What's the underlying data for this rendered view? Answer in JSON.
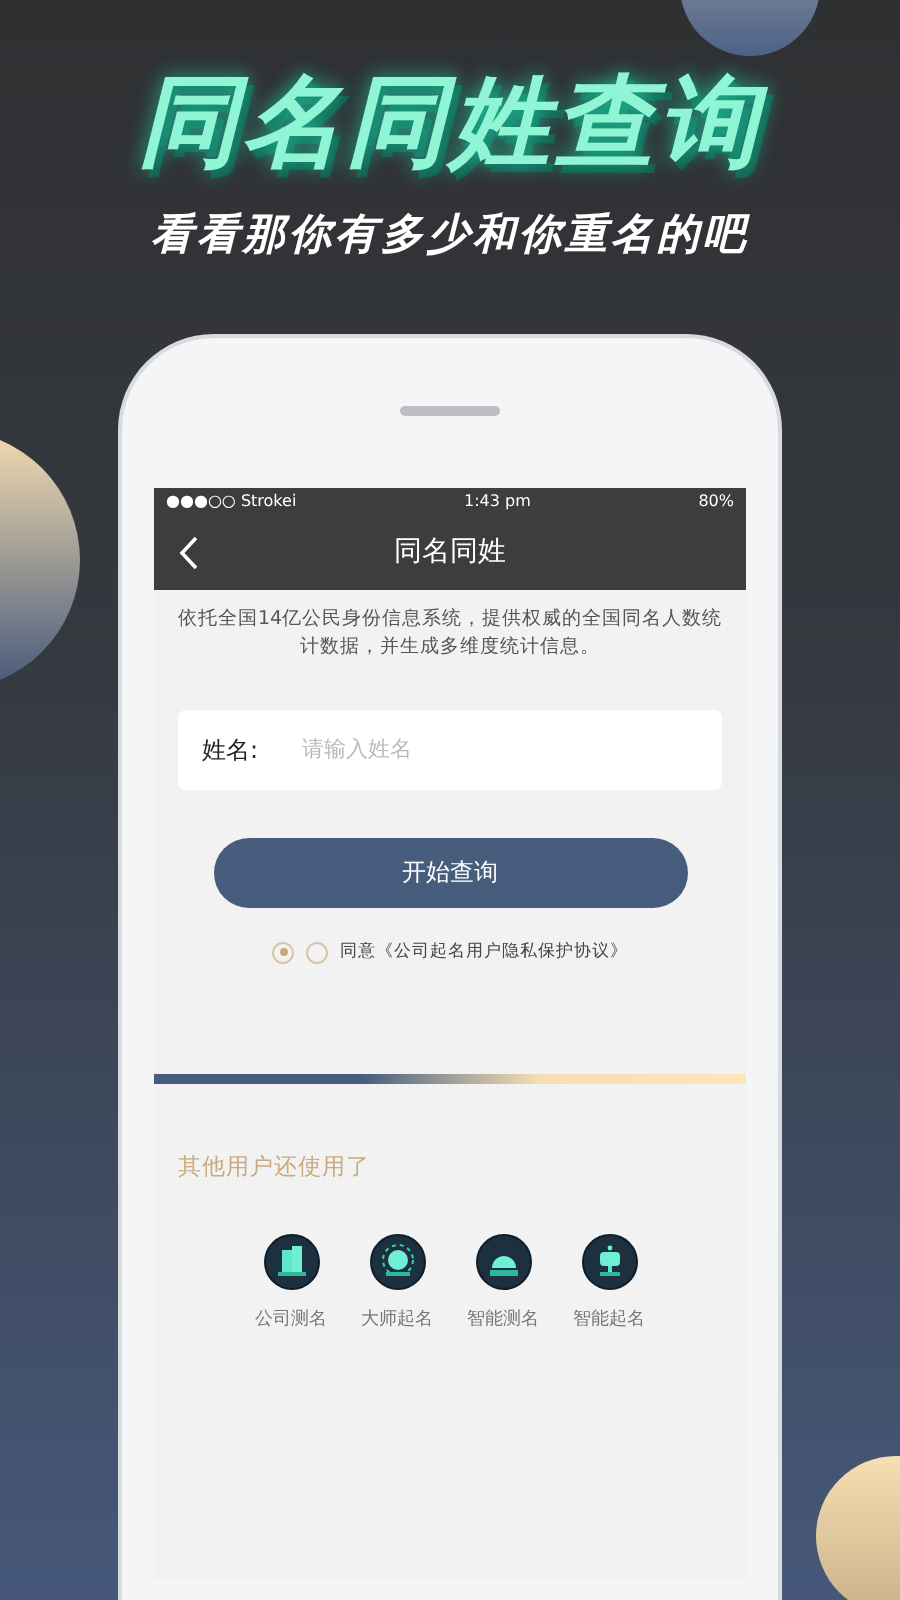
{
  "headline": "同名同姓查询",
  "subheadline": "看看那你有多少和你重名的吧",
  "status_bar": {
    "carrier": "●●●○○ Strokei",
    "time": "1:43 pm",
    "battery": "80%"
  },
  "nav": {
    "title": "同名同姓"
  },
  "description": "依托全国14亿公民身份信息系统，提供权威的全国同名人数统计数据，并生成多维度统计信息。",
  "name_field": {
    "label": "姓名:",
    "placeholder": "请输入姓名"
  },
  "search_button": "开始查询",
  "agreement": {
    "radios": [
      {
        "selected": true
      },
      {
        "selected": false
      }
    ],
    "text": "同意《公司起名用户隐私保护协议》"
  },
  "others": {
    "title": "其他用户还使用了",
    "items": [
      {
        "kind": "building",
        "label": "公司测名"
      },
      {
        "kind": "sun",
        "label": "大师起名"
      },
      {
        "kind": "dome",
        "label": "智能测名"
      },
      {
        "kind": "robot",
        "label": "智能起名"
      }
    ]
  }
}
